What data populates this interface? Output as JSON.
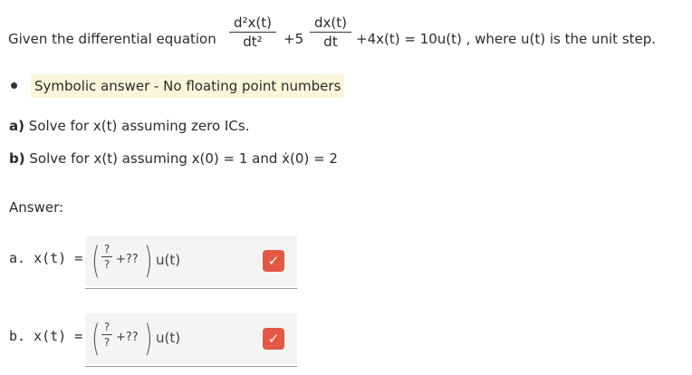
{
  "question": {
    "prefix": "Given the differential equation",
    "term1_num": "d²x(t)",
    "term1_den": "dt²",
    "plus5": "+5",
    "term2_num": "dx(t)",
    "term2_den": "dt",
    "rest": "+4x(t) = 10u(t) , where u(t) is the unit step."
  },
  "note": "Symbolic answer - No floating point numbers",
  "part_a": {
    "label": "a)",
    "text": "Solve for x(t) assuming zero ICs."
  },
  "part_b": {
    "label": "b)",
    "text": "Solve for x(t) assuming x(0)  =  1 and ẋ(0) = 2"
  },
  "answer_label": "Answer:",
  "answers": [
    {
      "prefix": "a. x(t) =",
      "frac_num": "?",
      "frac_den": "?",
      "plus": "+??",
      "suffix": "u(t)",
      "check": "✓"
    },
    {
      "prefix": "b. x(t) =",
      "frac_num": "?",
      "frac_den": "?",
      "plus": "+??",
      "suffix": "u(t)",
      "check": "✓"
    }
  ],
  "colors": {
    "highlight": "#fbf5d9",
    "check_button": "#e25844"
  }
}
